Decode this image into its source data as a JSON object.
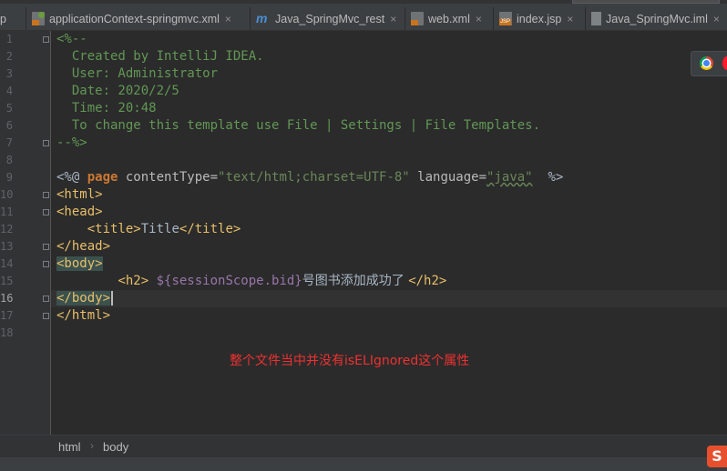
{
  "tabs": [
    {
      "label": "p",
      "icon": "jsp-file-icon"
    },
    {
      "label": "applicationContext-springmvc.xml",
      "icon": "spring-xml-file-icon"
    },
    {
      "label": "Java_SpringMvc_rest",
      "icon": "module-icon"
    },
    {
      "label": "web.xml",
      "icon": "xml-file-icon"
    },
    {
      "label": "index.jsp",
      "icon": "jsp-file-icon"
    },
    {
      "label": "Java_SpringMvc.iml",
      "icon": "iml-file-icon"
    }
  ],
  "tab_close_glyph": "×",
  "line_numbers": [
    "1",
    "2",
    "3",
    "4",
    "5",
    "6",
    "7",
    "8",
    "9",
    "10",
    "11",
    "12",
    "13",
    "14",
    "15",
    "16",
    "17",
    "18"
  ],
  "active_line": "16",
  "code": {
    "l1": "<%--",
    "l2": "  Created by IntelliJ IDEA.",
    "l3": "  User: Administrator",
    "l4": "  Date: 2020/2/5",
    "l5": "  Time: 20:48",
    "l6": "  To change this template use File | Settings | File Templates.",
    "l7": "--%>",
    "l9_open": "<%@ ",
    "l9_page": "page",
    "l9_attr1": " contentType=",
    "l9_val1": "\"text/html;charset=UTF-8\"",
    "l9_attr2": " language=",
    "l9_val2": "\"java\"",
    "l9_close": "  %>",
    "tag_html_open": "<html>",
    "tag_head_open": "<head>",
    "l12_indent": "    ",
    "tag_title_open": "<title>",
    "l12_text": "Title",
    "tag_title_close": "</title>",
    "tag_head_close": "</head>",
    "tag_body_open": "<body>",
    "l15_indent": "        ",
    "tag_h2_open": "<h2>",
    "l15_el": " ${sessionScope.bid}",
    "l15_text": "号图书添加成功了 ",
    "tag_h2_close": "</h2>",
    "tag_body_close": "</body>",
    "tag_html_close": "</html>"
  },
  "annotation": "整个文件当中并没有isELIgnored这个属性",
  "breadcrumb": [
    "html",
    "body"
  ],
  "breadcrumb_sep": "›",
  "browser_icons": [
    "chrome-icon",
    "opera-icon"
  ],
  "ime_logo_letter": "S",
  "colors": {
    "editor_bg": "#2b2b2b",
    "tag": "#e8bf6a",
    "comment": "#629755",
    "string": "#6a8759",
    "keyword": "#cc7832",
    "annotation": "#f03030"
  }
}
